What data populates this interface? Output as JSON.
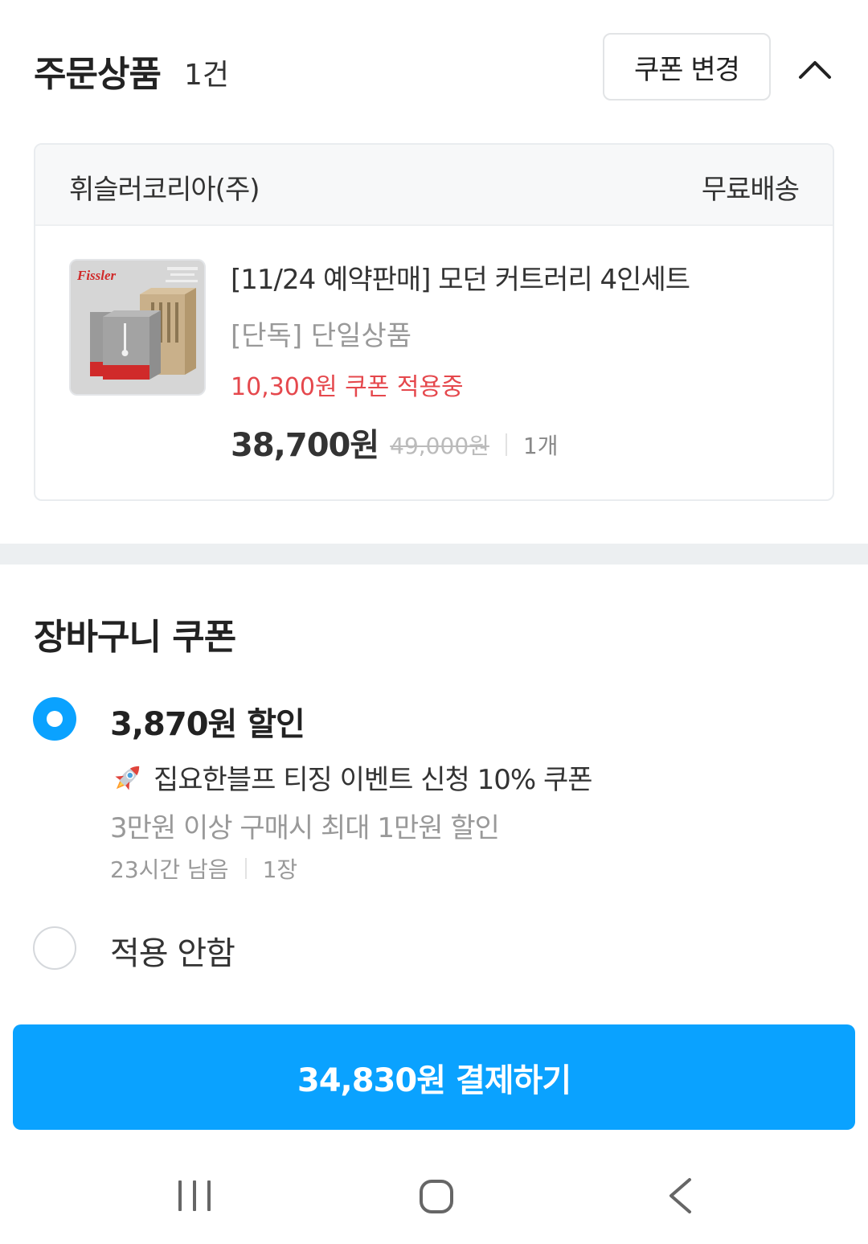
{
  "header": {
    "title": "주문상품",
    "count": "1건",
    "coupon_change_label": "쿠폰 변경"
  },
  "seller": {
    "name": "휘슬러코리아(주)",
    "shipping": "무료배송"
  },
  "product": {
    "thumb_brand": "Fissler",
    "name": "[11/24 예약판매] 모던 커트러리 4인세트",
    "option": "[단독] 단일상품",
    "coupon_applied": "10,300원 쿠폰 적용중",
    "price_final": "38,700원",
    "price_original": "49,000원",
    "quantity": "1개"
  },
  "cart_coupon": {
    "title": "장바구니 쿠폰",
    "options": [
      {
        "amount": "3,870원 할인",
        "name": "집요한블프 티징 이벤트 신청 10% 쿠폰",
        "icon": "rocket-icon",
        "condition": "3만원 이상 구매시 최대 1만원 할인",
        "remaining": "23시간 남음",
        "count": "1장",
        "selected": true
      },
      {
        "label": "적용 안함",
        "selected": false
      }
    ]
  },
  "pay_button": {
    "label": "34,830원 결제하기"
  },
  "colors": {
    "accent": "#0aa2ff",
    "coupon_red": "#e5484d",
    "muted": "#999999"
  },
  "system_nav": {
    "icons": [
      "recents-icon",
      "home-icon",
      "back-icon"
    ]
  }
}
